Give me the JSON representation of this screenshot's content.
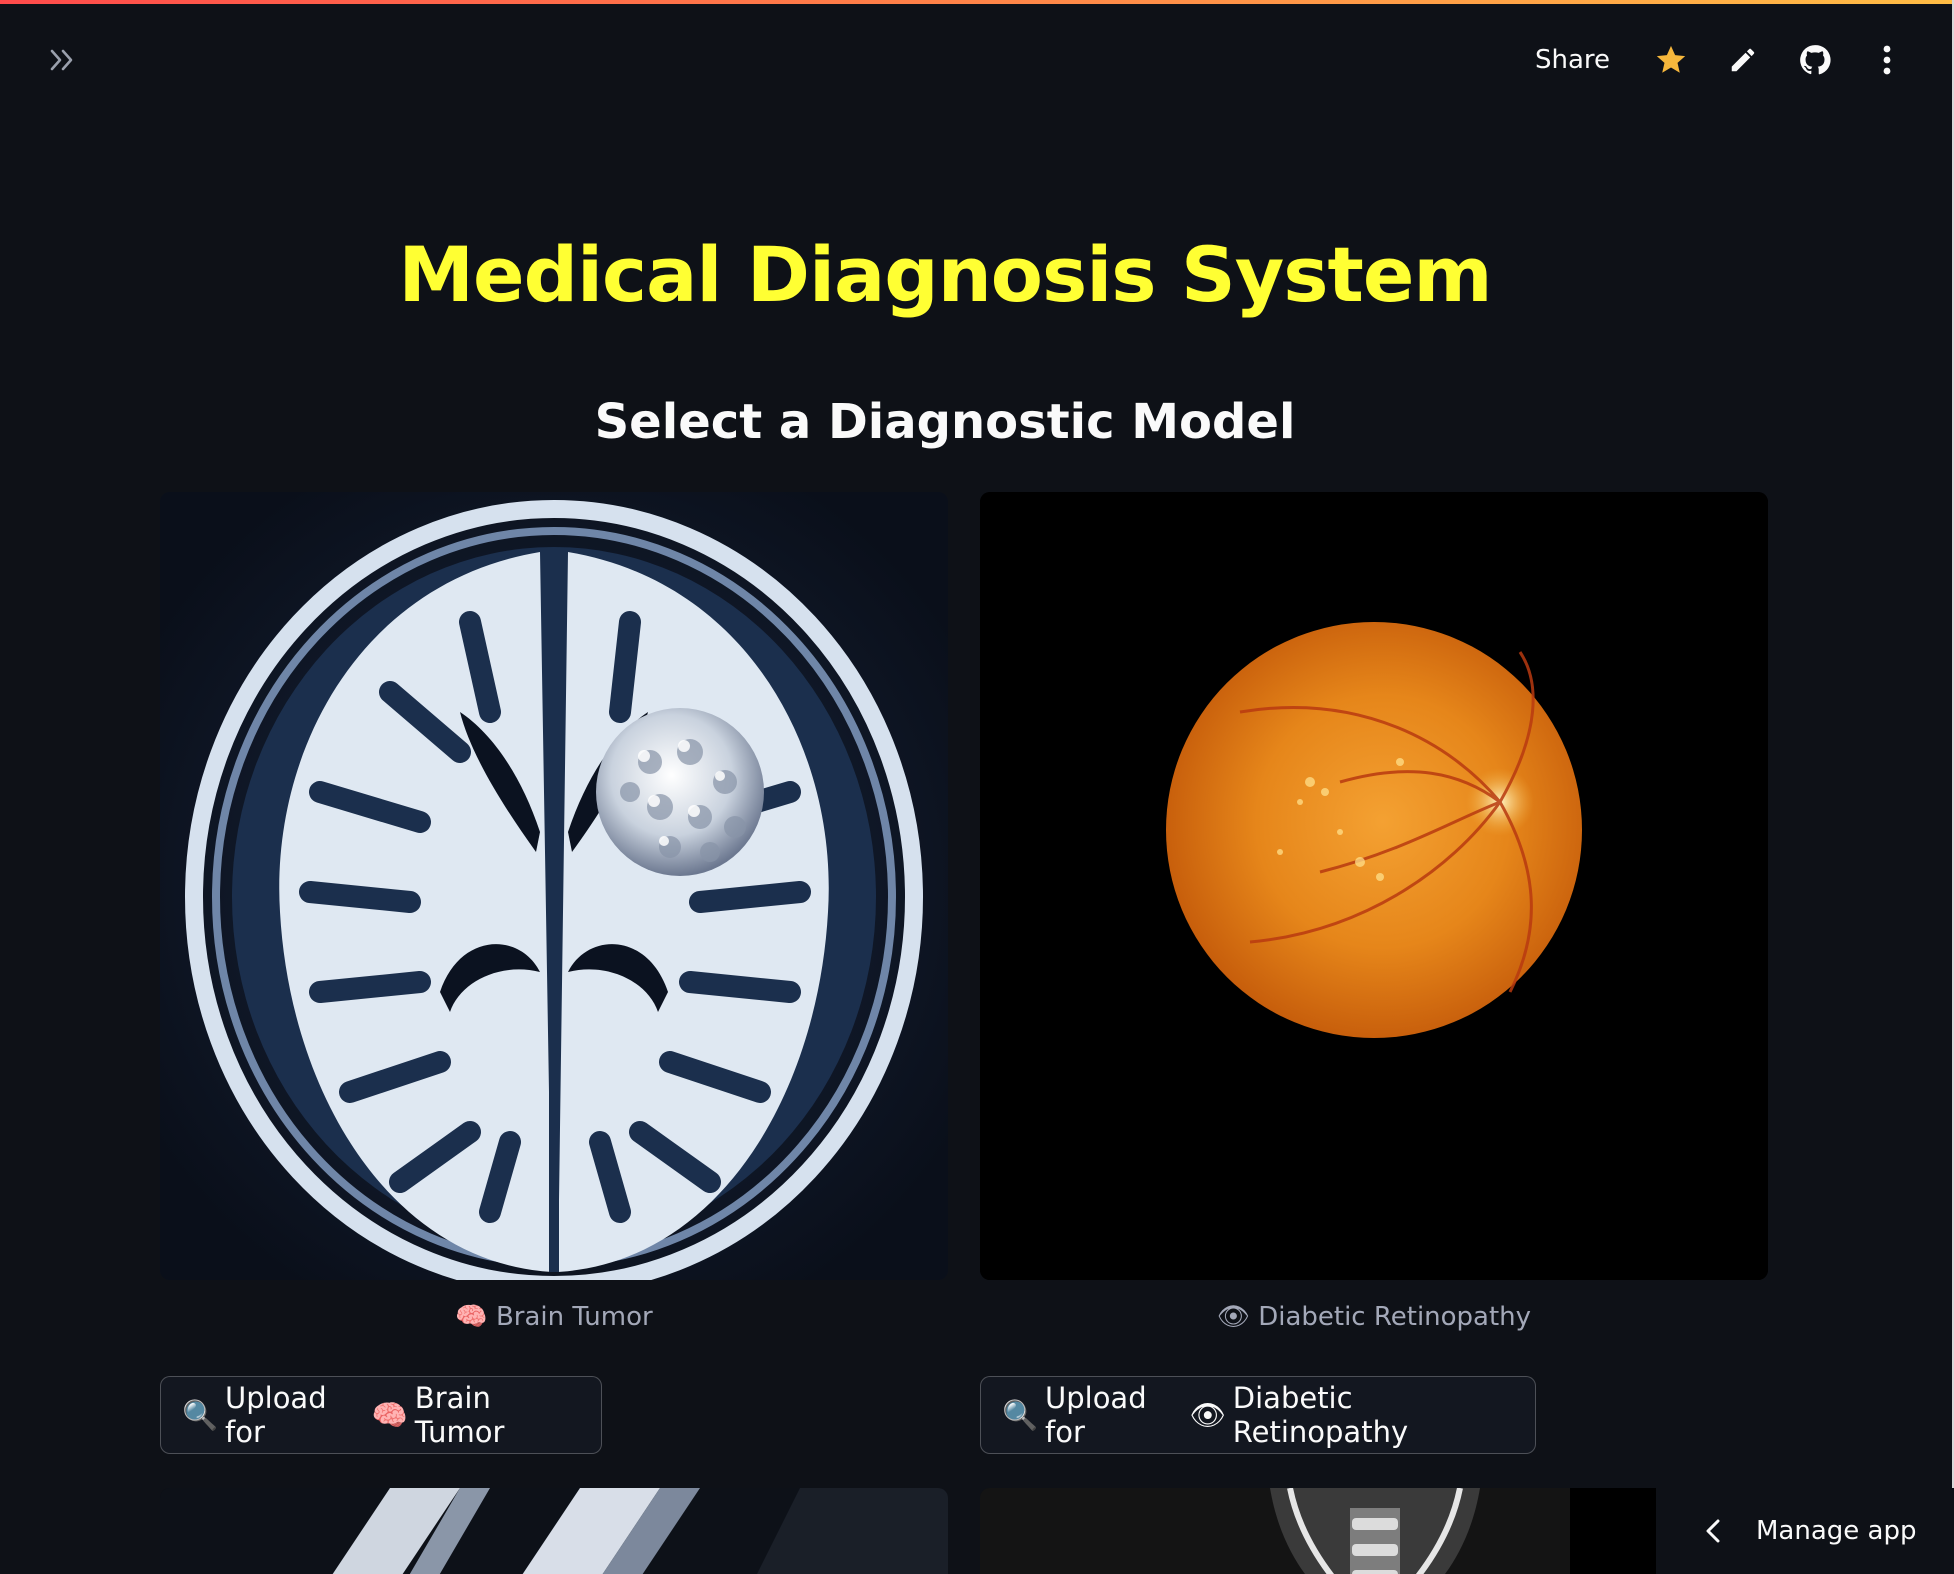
{
  "header": {
    "share_label": "Share",
    "icons": [
      "sidebar-expand-icon",
      "star-icon",
      "edit-pencil-icon",
      "github-icon",
      "more-vertical-icon"
    ],
    "star_color": "#f6b73c"
  },
  "main": {
    "title": "Medical Diagnosis System",
    "title_color": "#ffff33",
    "subtitle": "Select a Diagnostic Model",
    "models": [
      {
        "caption_emoji": "🧠",
        "caption": "Brain Tumor",
        "button_search_emoji": "🔍",
        "button_prefix": "Upload for",
        "button_emoji": "🧠",
        "button_label": "Brain Tumor"
      },
      {
        "caption_emoji": "👁",
        "caption": "Diabetic Retinopathy",
        "button_search_emoji": "🔍",
        "button_prefix": "Upload for",
        "button_emoji": "👁",
        "button_label": "Diabetic Retinopathy"
      }
    ]
  },
  "footer": {
    "manage_app_label": "Manage app"
  }
}
